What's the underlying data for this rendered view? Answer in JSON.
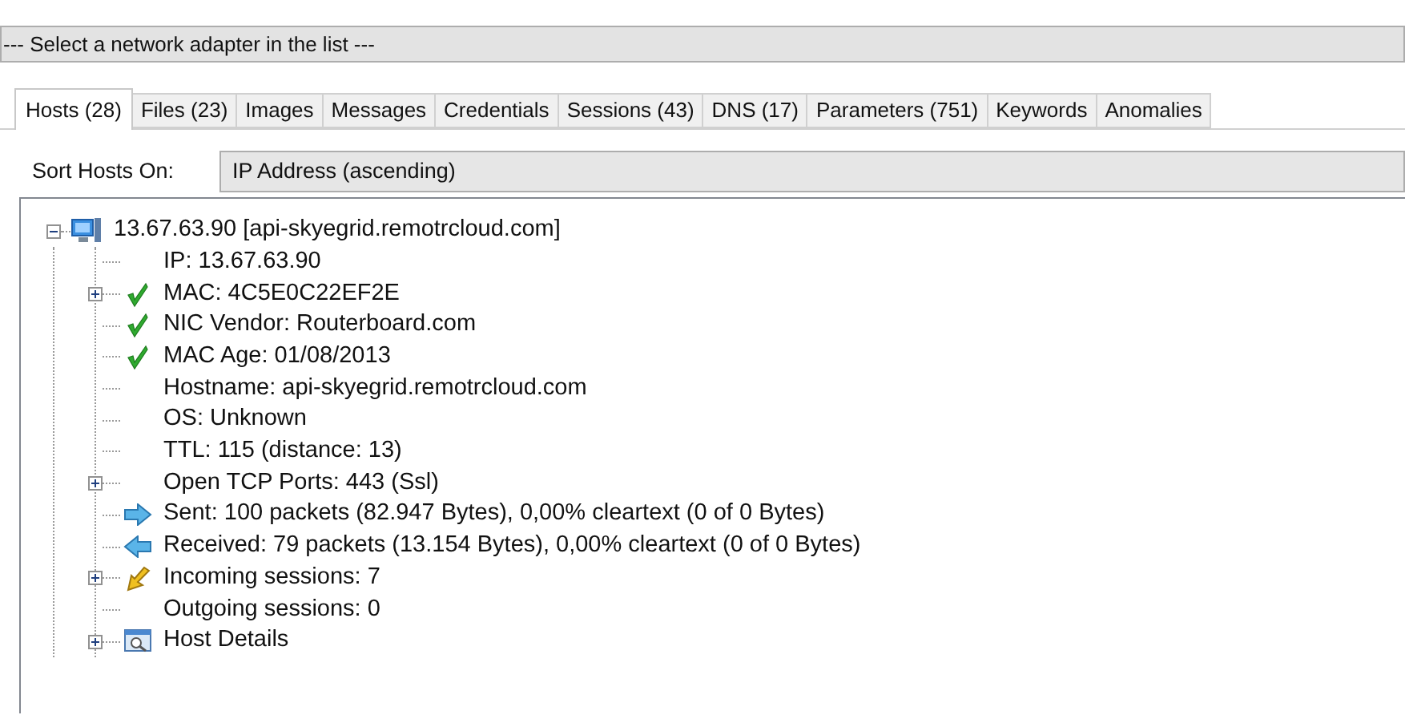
{
  "adapter_selector": {
    "value": "--- Select a network adapter in the list ---"
  },
  "tabs": [
    {
      "label": "Hosts (28)",
      "selected": true
    },
    {
      "label": "Files (23)",
      "selected": false
    },
    {
      "label": "Images",
      "selected": false
    },
    {
      "label": "Messages",
      "selected": false
    },
    {
      "label": "Credentials",
      "selected": false
    },
    {
      "label": "Sessions (43)",
      "selected": false
    },
    {
      "label": "DNS (17)",
      "selected": false
    },
    {
      "label": "Parameters (751)",
      "selected": false
    },
    {
      "label": "Keywords",
      "selected": false
    },
    {
      "label": "Anomalies",
      "selected": false
    }
  ],
  "sort": {
    "label": "Sort Hosts On:",
    "value": "IP Address (ascending)"
  },
  "tree": {
    "text": "13.67.63.90 [api-skyegrid.remotrcloud.com]",
    "kind": "computer",
    "expanded": true,
    "children": [
      {
        "text": "IP: 13.67.63.90",
        "kind": "plain",
        "expandable": false
      },
      {
        "text": "MAC: 4C5E0C22EF2E",
        "kind": "check",
        "expandable": true
      },
      {
        "text": "NIC Vendor: Routerboard.com",
        "kind": "check",
        "expandable": false
      },
      {
        "text": "MAC Age: 01/08/2013",
        "kind": "check",
        "expandable": false
      },
      {
        "text": "Hostname: api-skyegrid.remotrcloud.com",
        "kind": "plain",
        "expandable": false
      },
      {
        "text": "OS: Unknown",
        "kind": "plain",
        "expandable": false
      },
      {
        "text": "TTL: 115 (distance: 13)",
        "kind": "plain",
        "expandable": false
      },
      {
        "text": "Open TCP Ports: 443 (Ssl)",
        "kind": "plain",
        "expandable": true
      },
      {
        "text": "Sent: 100 packets (82.947 Bytes), 0,00% cleartext (0 of 0 Bytes)",
        "kind": "sent",
        "expandable": false
      },
      {
        "text": "Received: 79 packets (13.154 Bytes), 0,00% cleartext (0 of 0 Bytes)",
        "kind": "received",
        "expandable": false
      },
      {
        "text": "Incoming sessions: 7",
        "kind": "incoming",
        "expandable": true
      },
      {
        "text": "Outgoing sessions: 0",
        "kind": "plain",
        "expandable": false
      },
      {
        "text": "Host Details",
        "kind": "details",
        "expandable": true
      }
    ]
  }
}
